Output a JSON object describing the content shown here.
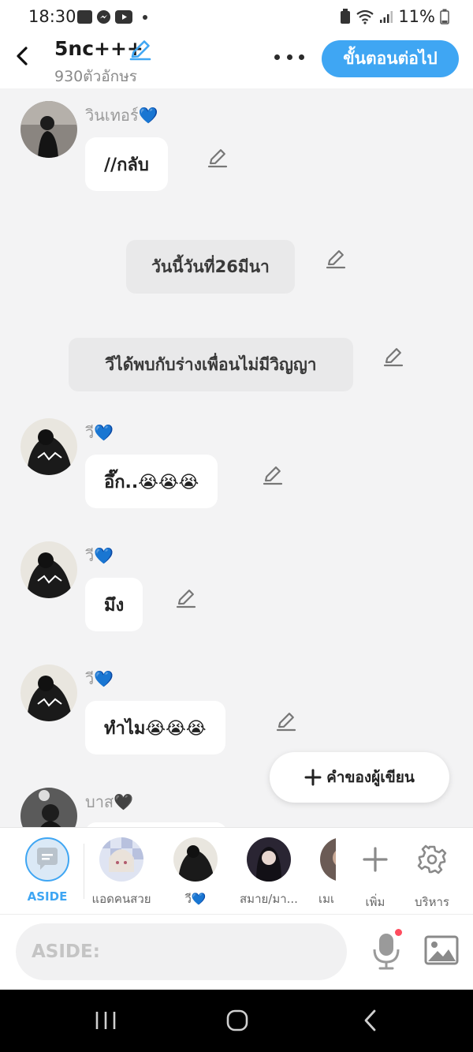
{
  "status": {
    "time": "18:30",
    "battery": "11%"
  },
  "header": {
    "title": "5nc+++",
    "subtitle": "930ตัวอักษร",
    "next_label": "ขั้นตอนต่อไป"
  },
  "messages": [
    {
      "sender": "วินเทอร์",
      "heart": "💙",
      "text": "//กลับ"
    },
    {
      "narration": "วันนี้วันที่26มีนา"
    },
    {
      "narration": "วีได้พบกับร่างเพื่อนไม่มีวิญญา"
    },
    {
      "sender": "วี",
      "heart": "💙",
      "text": "อึ๊ก..😭😭😭"
    },
    {
      "sender": "วี",
      "heart": "💙",
      "text": "มึง"
    },
    {
      "sender": "วี",
      "heart": "💙",
      "text": "ทำไม😭😭😭"
    },
    {
      "sender": "บาส",
      "heart": "🖤"
    }
  ],
  "author_words": "คำของผู้เขียน",
  "characters": [
    {
      "label": "ASIDE"
    },
    {
      "label": "แอดคนสวย"
    },
    {
      "label": "วี💙"
    },
    {
      "label": "สมาย/มา..."
    },
    {
      "label": "เมเ"
    }
  ],
  "actions": {
    "add_label": "เพิ่ม",
    "manage_label": "บริหาร"
  },
  "input": {
    "placeholder": "ASIDE:"
  },
  "colors": {
    "accent": "#3fa6f3",
    "background": "#f3f3f4",
    "bubble": "#ffffff",
    "narration": "#e9e9ea"
  }
}
